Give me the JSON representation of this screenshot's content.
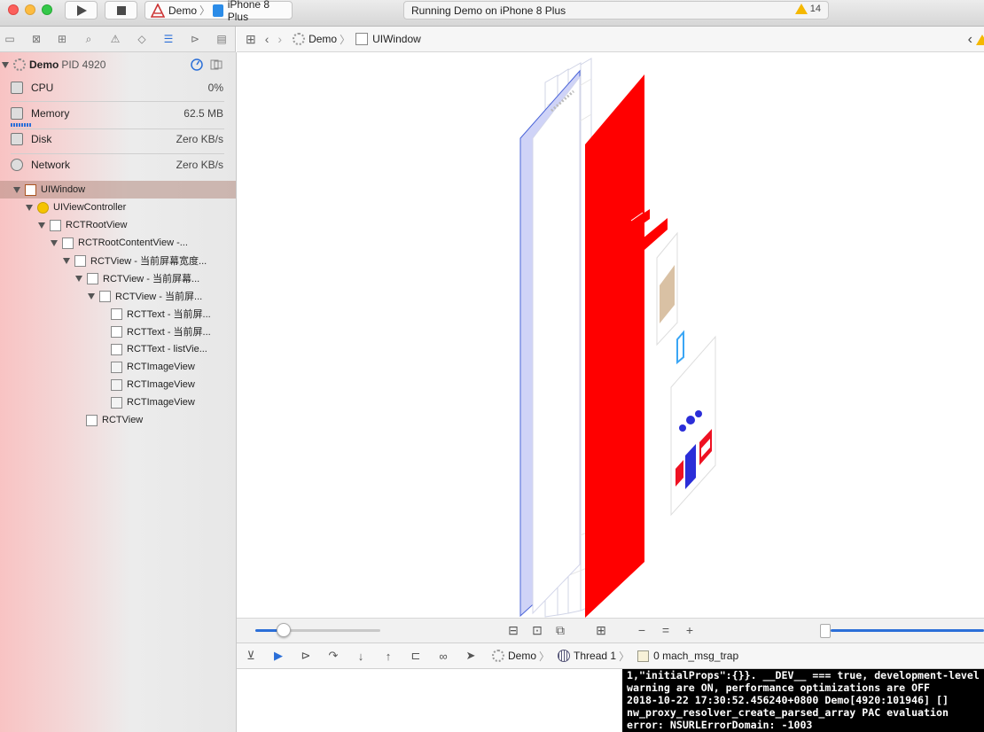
{
  "window": {
    "scheme_app": "Demo",
    "scheme_device": "iPhone 8 Plus",
    "activity_status": "Running Demo on iPhone 8 Plus",
    "warning_count": "14"
  },
  "navigator": {
    "process": {
      "name": "Demo",
      "pid": "PID 4920"
    },
    "gauges": [
      {
        "label": "CPU",
        "value": "0%"
      },
      {
        "label": "Memory",
        "value": "62.5 MB"
      },
      {
        "label": "Disk",
        "value": "Zero KB/s"
      },
      {
        "label": "Network",
        "value": "Zero KB/s"
      }
    ],
    "tree": [
      {
        "label": "UIWindow"
      },
      {
        "label": "UIViewController"
      },
      {
        "label": "RCTRootView"
      },
      {
        "label": "RCTRootContentView -..."
      },
      {
        "label": "RCTView -    当前屏幕宽度..."
      },
      {
        "label": "RCTView -    当前屏幕..."
      },
      {
        "label": "RCTView -  当前屏..."
      },
      {
        "label": "RCTText - 当前屏..."
      },
      {
        "label": "RCTText - 当前屏..."
      },
      {
        "label": "RCTText - listVie..."
      },
      {
        "label": "RCTImageView"
      },
      {
        "label": "RCTImageView"
      },
      {
        "label": "RCTImageView"
      },
      {
        "label": "RCTView"
      }
    ]
  },
  "jumpbar": {
    "crumbs": [
      "Demo",
      "UIWindow"
    ]
  },
  "debugbar": {
    "crumbs": [
      "Demo",
      "Thread 1",
      "0 mach_msg_trap"
    ]
  },
  "console": {
    "lines": [
      "1,\"initialProps\":{}}. __DEV__ === true, development-level",
      "warning are ON, performance optimizations are OFF",
      "2018-10-22 17:30:52.456240+0800 Demo[4920:101946] []",
      "nw_proxy_resolver_create_parsed_array PAC evaluation",
      "error: NSURLErrorDomain: -1003"
    ]
  },
  "colors": {
    "selection": "#b48c82",
    "accent": "#2b6fd8",
    "red_layer": "#ff0000",
    "console_bg": "#000000"
  }
}
